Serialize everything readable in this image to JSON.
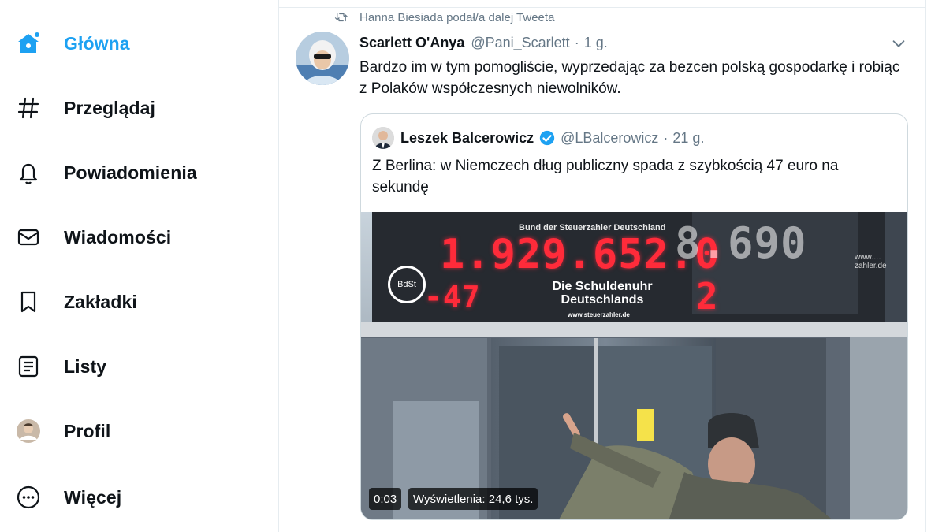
{
  "nav": {
    "items": [
      {
        "label": "Główna",
        "icon": "home-icon"
      },
      {
        "label": "Przeglądaj",
        "icon": "hashtag-icon"
      },
      {
        "label": "Powiadomienia",
        "icon": "bell-icon"
      },
      {
        "label": "Wiadomości",
        "icon": "mail-icon"
      },
      {
        "label": "Zakładki",
        "icon": "bookmark-icon"
      },
      {
        "label": "Listy",
        "icon": "list-icon"
      },
      {
        "label": "Profil",
        "icon": "profile-avatar"
      },
      {
        "label": "Więcej",
        "icon": "more-circle-icon"
      }
    ],
    "active_index": 0
  },
  "retweet": {
    "text": "Hanna Biesiada podał/a dalej Tweeta",
    "icon": "retweet-icon"
  },
  "tweet": {
    "author_name": "Scarlett O'Anya",
    "handle": "@Pani_Scarlett",
    "separator": "·",
    "time": "1 g.",
    "text": "Bardzo im w tym pomogliście, wyprzedając za bezcen polską gospodarkę i robiąc z Polaków współczesnych niewolników."
  },
  "quote": {
    "author_name": "Leszek Balcerowicz",
    "handle": "@LBalcerowicz",
    "separator": "·",
    "time": "21 g.",
    "text": "Z Berlina: w Niemczech dług publiczny spada z szybkością 47 euro na sekundę",
    "media": {
      "clock_top_label": "Bund der Steuerzahler Deutschland",
      "clock_main_number": "1.929.652.0",
      "clock_sub_number": "-47",
      "clock_right_number": "8.690",
      "clock_right_sub": "2",
      "clock_title": "Die Schuldenuhr Deutschlands",
      "clock_website": "www.steuerzahler.de",
      "logo_text": "BdSt",
      "right_website": "www.…zahler.de",
      "video_time": "0:03",
      "views": "Wyświetlenia: 24,6 tys."
    }
  },
  "colors": {
    "accent": "#1da1f2",
    "text": "#0f1419",
    "muted": "#657786",
    "verified": "#1da1f2",
    "border": "#e6ecf0"
  }
}
